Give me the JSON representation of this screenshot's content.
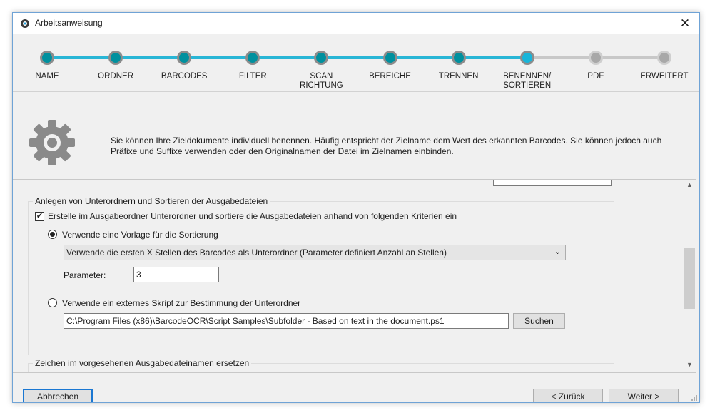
{
  "window": {
    "title": "Arbeitsanweisung",
    "close_glyph": "✕"
  },
  "steps": [
    {
      "label": "NAME",
      "state": "done"
    },
    {
      "label": "ORDNER",
      "state": "done"
    },
    {
      "label": "BARCODES",
      "state": "done"
    },
    {
      "label": "FILTER",
      "state": "done"
    },
    {
      "label": "SCAN\nRICHTUNG",
      "state": "done"
    },
    {
      "label": "BEREICHE",
      "state": "done"
    },
    {
      "label": "TRENNEN",
      "state": "done"
    },
    {
      "label": "BENENNEN/\nSORTIEREN",
      "state": "current"
    },
    {
      "label": "PDF",
      "state": "todo"
    },
    {
      "label": "ERWEITERT",
      "state": "todo"
    }
  ],
  "info": {
    "icon": "gear-icon",
    "text": "Sie können Ihre Zieldokumente individuell benennen. Häufig entspricht der Zielname dem Wert des erkannten Barcodes. Sie können jedoch auch Präfixe und Suffixe verwenden oder den Originalnamen der Datei im Zielnamen einbinden."
  },
  "subfolder_group": {
    "legend": "Anlegen von Unterordnern und Sortieren der Ausgabedateien",
    "checkbox_label": "Erstelle im Ausgabeordner Unterordner und sortiere die Ausgabedateien anhand von folgenden Kriterien ein",
    "checkbox_checked": true,
    "option_template_label": "Verwende eine Vorlage für die Sortierung",
    "option_template_selected": true,
    "template_select_value": "Verwende die ersten X Stellen des Barcodes als Unterordner (Parameter definiert Anzahl an Stellen)",
    "parameter_label": "Parameter:",
    "parameter_value": "3",
    "option_script_label": "Verwende ein externes Skript zur Bestimmung der Unterordner",
    "option_script_selected": false,
    "script_path": "C:\\Program Files (x86)\\BarcodeOCR\\Script Samples\\Subfolder - Based on text in the document.ps1",
    "search_button": "Suchen"
  },
  "replace_group": {
    "legend": "Zeichen im vorgesehenen Ausgabedateinamen ersetzen"
  },
  "footer": {
    "cancel": "Abbrechen",
    "back": "< Zurück",
    "next": "Weiter >"
  },
  "colors": {
    "step_done": "#00909e",
    "step_current": "#19b5d9",
    "step_line_done": "#29b6d6",
    "step_line_todo": "#c8c8c8",
    "accent_border": "#1a77d2"
  }
}
